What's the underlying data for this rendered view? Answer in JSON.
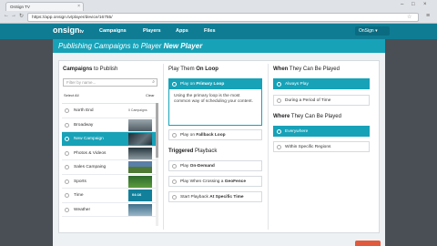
{
  "browser": {
    "tab_title": "OnSign TV",
    "url": "https://app.onsign.tv/player/device/16755/",
    "close_glyph": "×",
    "back_glyph": "←",
    "forward_glyph": "→",
    "reload_glyph": "↻",
    "star_glyph": "☆",
    "menu_glyph": "≡",
    "win_min": "–",
    "win_max": "□",
    "win_close": "×"
  },
  "appnav": {
    "logo_main": "onsign",
    "logo_suffix": "tv",
    "links": [
      "Campaigns",
      "Players",
      "Apps",
      "Files"
    ],
    "user_label": "OnSign ▾"
  },
  "banner": {
    "prefix": "Publishing Campaigns to Player ",
    "player_name": "New Player"
  },
  "campaigns": {
    "heading_bold": "Campaigns",
    "heading_rest": " to Publish",
    "filter_placeholder": "Filter by name...",
    "select_all": "Select All",
    "clear": "Clear",
    "items": [
      {
        "label": "North End",
        "badge": "0 Campaigns"
      },
      {
        "label": "Broadway",
        "badge": ""
      },
      {
        "label": "New Campaign",
        "badge": ""
      },
      {
        "label": "Photos & Videos",
        "badge": ""
      },
      {
        "label": "Sales Campaing",
        "badge": ""
      },
      {
        "label": "Sports",
        "badge": ""
      },
      {
        "label": "Time",
        "badge": "",
        "thumb_label": "04:16"
      },
      {
        "label": "Weather",
        "badge": ""
      }
    ],
    "selected_index": 2
  },
  "play_loop": {
    "heading_a": "Play Them ",
    "heading_b": "On Loop",
    "primary_a": "Play on ",
    "primary_b": "Primary Loop",
    "description": "Using the primary loop is the most common way of scheduling your content.",
    "fallback_a": "Play on ",
    "fallback_b": "Fallback Loop"
  },
  "triggered": {
    "heading_a": "Triggered",
    "heading_b": " Playback",
    "on_demand_a": "Play ",
    "on_demand_b": "On-Demand",
    "geofence_a": "Play When Crossing a ",
    "geofence_b": "GeoFence",
    "specific_a": "Start Playback ",
    "specific_b": "At Specific Time"
  },
  "when": {
    "heading_a": "When",
    "heading_b": " They Can Be Played",
    "always": "Always Play",
    "period": "During a Period of Time"
  },
  "where": {
    "heading_a": "Where",
    "heading_b": " They Can Be Played",
    "everywhere": "Everywhere",
    "regions": "Within Specific Regions"
  },
  "colors": {
    "accent": "#17a2b8",
    "nav": "#0f7c93",
    "page_bg": "#eef1f3"
  }
}
